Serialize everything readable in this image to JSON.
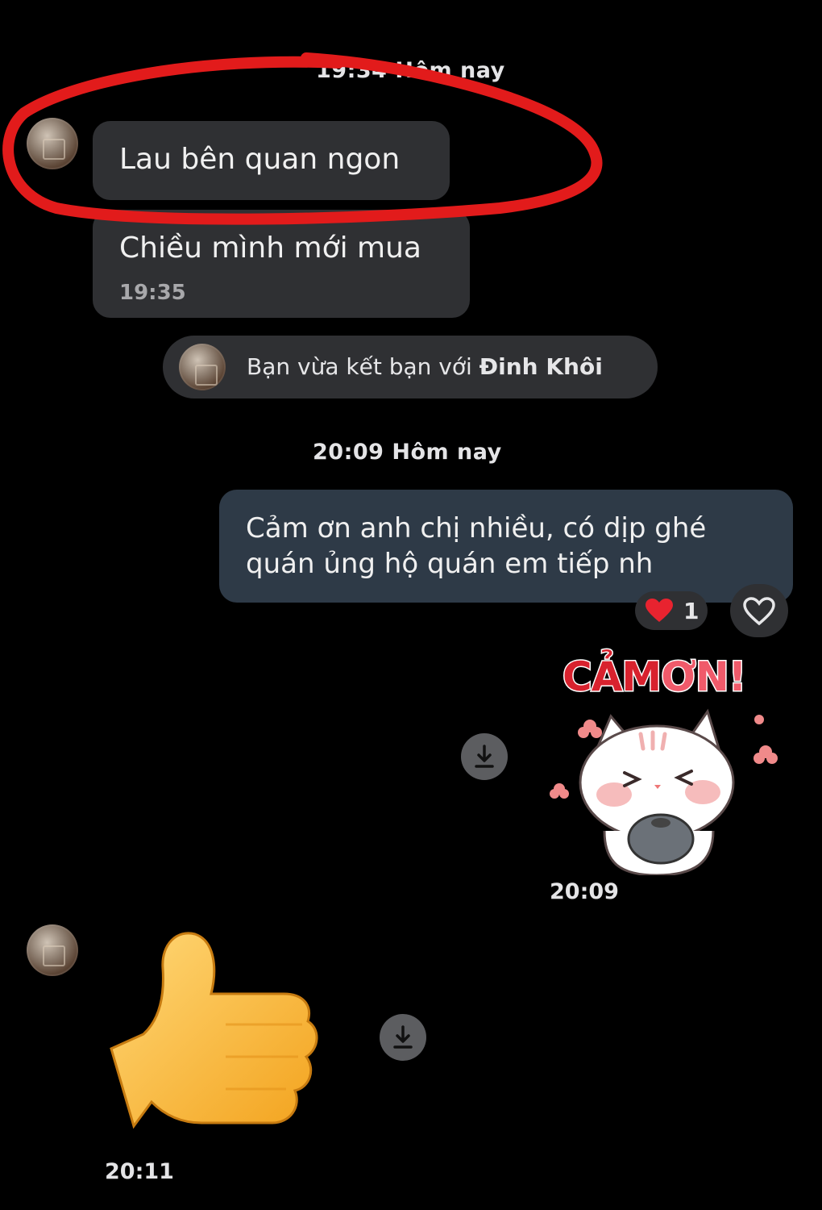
{
  "messages": {
    "top_timestamp": "19:34 Hôm nay",
    "msg1": "Lau bên quan ngon",
    "msg2": "Chiều mình mới mua",
    "msg2_time": "19:35",
    "system_prefix": "Bạn vừa kết bạn với ",
    "system_name": "Đinh Khôi",
    "timestamp2": "20:09 Hôm nay",
    "reply_text": "Cảm ơn anh chị nhiều, có dịp ghé quán ủng hộ quán em tiếp nh",
    "reaction_count": "1",
    "sticker_text_1": "CẢM",
    "sticker_text_2": "ƠN!",
    "sticker_time": "20:09",
    "thumb_time": "20:11"
  },
  "colors": {
    "background": "#000000",
    "incoming_bubble": "#2f3033",
    "outgoing_bubble": "#2e3a47",
    "annotation": "#e21b1b"
  },
  "icons": [
    "download-icon",
    "heart-icon",
    "heart-outline-icon",
    "thumbs-up-icon",
    "avatar"
  ]
}
